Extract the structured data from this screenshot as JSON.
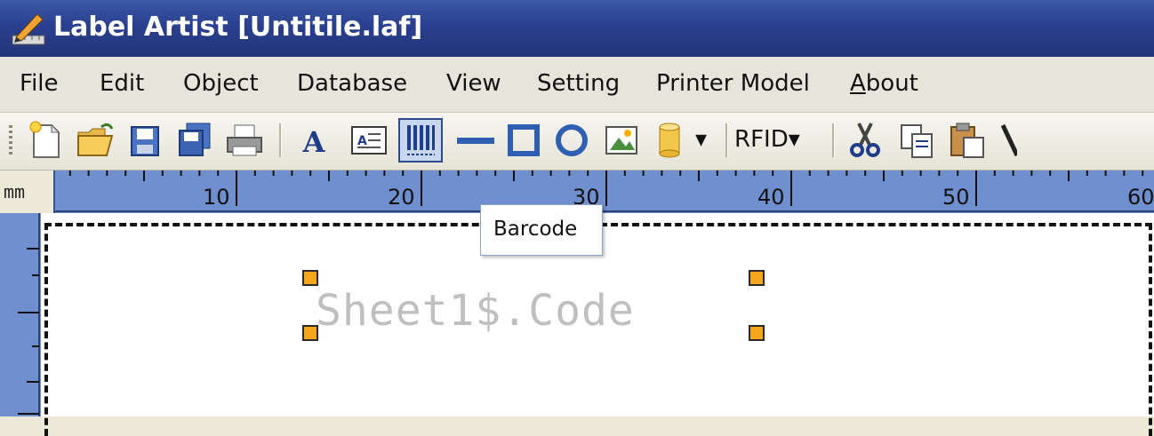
{
  "window": {
    "title": "Label Artist [Untitile.laf]",
    "app_icon": "pencil-ruler-icon"
  },
  "menu": {
    "items": [
      {
        "label": "File"
      },
      {
        "label": "Edit"
      },
      {
        "label": "Object"
      },
      {
        "label": "Database"
      },
      {
        "label": "View"
      },
      {
        "label": "Setting"
      },
      {
        "label": "Printer Model"
      },
      {
        "label": "About",
        "accelerator": "A"
      }
    ]
  },
  "toolbar": {
    "buttons": [
      {
        "icon": "new-file-icon"
      },
      {
        "icon": "open-folder-icon"
      },
      {
        "icon": "save-icon"
      },
      {
        "icon": "save-all-icon"
      },
      {
        "icon": "print-icon"
      },
      {
        "icon": "text-icon"
      },
      {
        "icon": "textbox-icon"
      },
      {
        "icon": "barcode-icon",
        "active": true
      },
      {
        "icon": "line-icon"
      },
      {
        "icon": "rectangle-icon"
      },
      {
        "icon": "ellipse-icon"
      },
      {
        "icon": "image-icon"
      },
      {
        "icon": "database-icon"
      },
      {
        "icon": "cut-icon"
      },
      {
        "icon": "copy-icon"
      },
      {
        "icon": "paste-icon"
      }
    ],
    "rfid_label": "RFID",
    "dropdown_arrow": "▾"
  },
  "ruler": {
    "unit": "mm",
    "numbers": [
      "10",
      "20",
      "30",
      "40",
      "50",
      "60"
    ]
  },
  "tooltip": {
    "text": "Barcode"
  },
  "canvas": {
    "object_text": "Sheet1$.Code"
  },
  "colors": {
    "titlebar": "#2a3f8e",
    "ruler": "#6f8fcf",
    "handle": "#f4a51c",
    "object_text": "#bfbfbf"
  }
}
